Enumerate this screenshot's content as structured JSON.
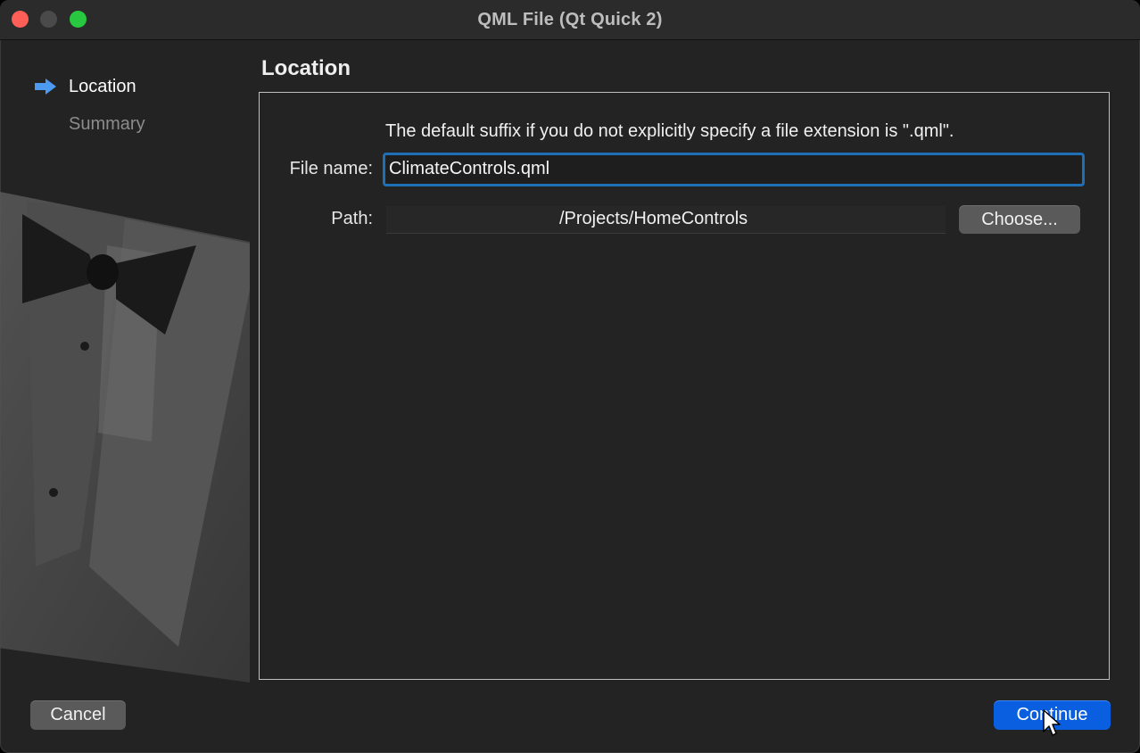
{
  "window": {
    "title": "QML File (Qt Quick 2)"
  },
  "sidebar": {
    "steps": [
      {
        "label": "Location",
        "active": true
      },
      {
        "label": "Summary",
        "active": false
      }
    ]
  },
  "main": {
    "page_title": "Location",
    "hint": "The default suffix if you do not explicitly specify a file extension is \".qml\".",
    "file_name": {
      "label": "File name:",
      "value": "ClimateControls.qml"
    },
    "path": {
      "label": "Path:",
      "value": "/Projects/HomeControls"
    },
    "choose_label": "Choose..."
  },
  "footer": {
    "cancel_label": "Cancel",
    "continue_label": "Continue"
  },
  "colors": {
    "accent": "#0a5fe0",
    "focus_ring": "#1f6fb6",
    "active_arrow": "#4d9bf0"
  }
}
